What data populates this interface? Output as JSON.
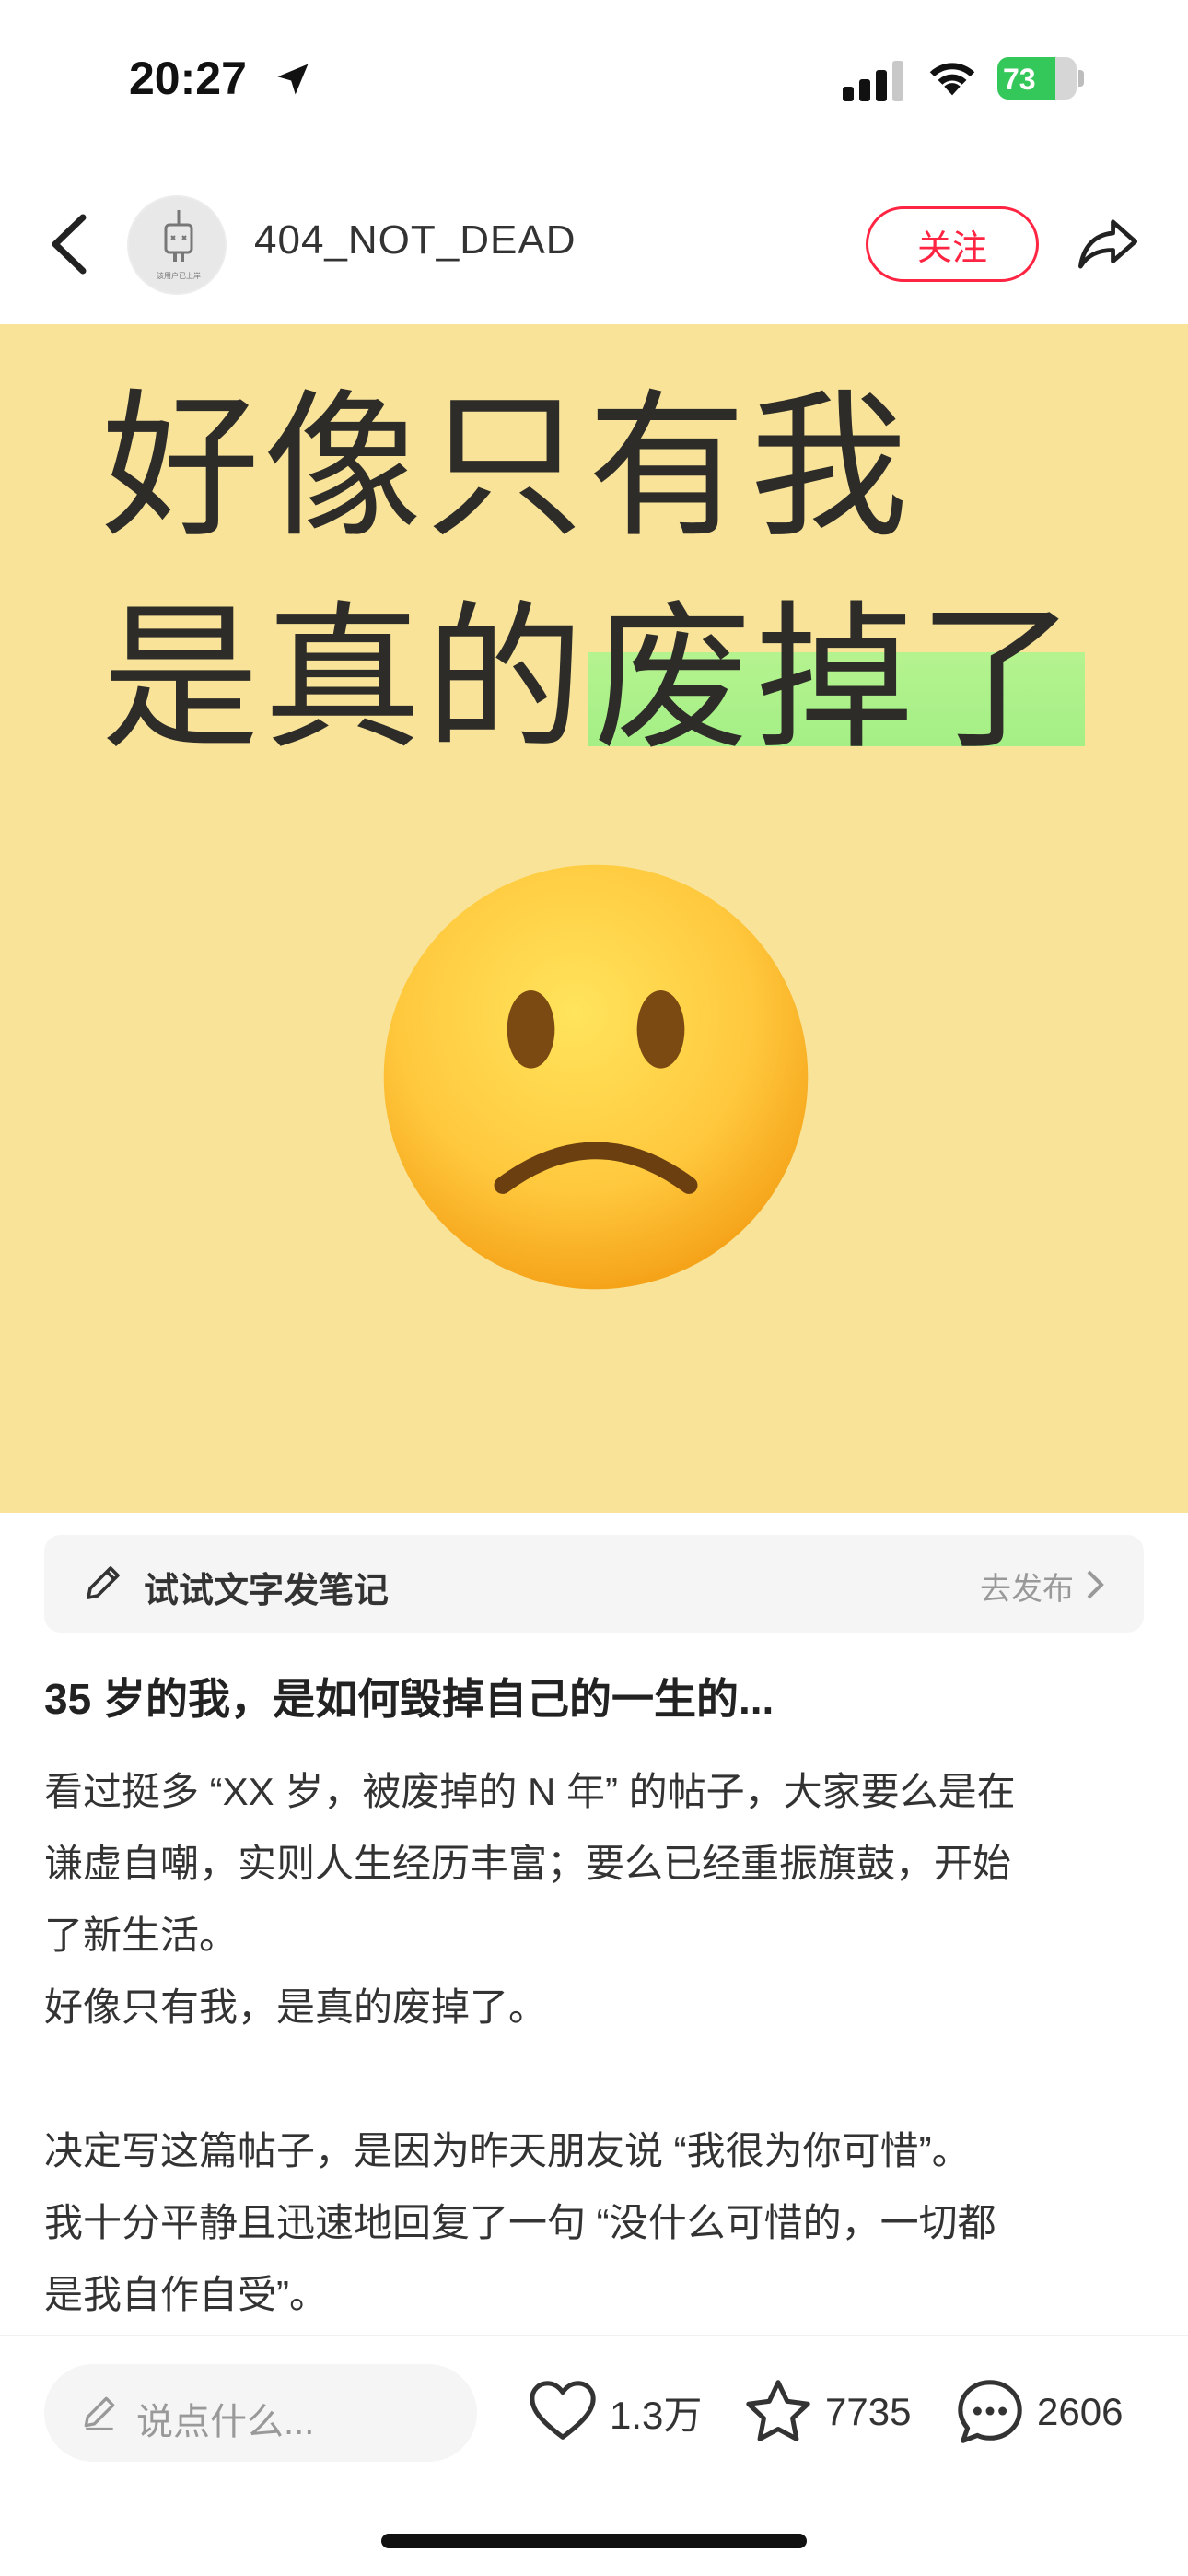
{
  "status_bar": {
    "time": "20:27",
    "battery": "73",
    "battery_level": 0.73,
    "icons": [
      "location-arrow-icon",
      "cellular-signal-icon",
      "wifi-icon",
      "battery-icon"
    ]
  },
  "header": {
    "username": "404_NOT_DEAD",
    "avatar_text": "该用户已上岸",
    "follow_label": "关注",
    "accent_color": "#ff2442",
    "icons": [
      "back-chevron-icon",
      "share-icon"
    ]
  },
  "image": {
    "background_color": "#f8e398",
    "line1": "好像只有我",
    "line2_plain": "是真的",
    "line2_highlight": "废掉了",
    "highlight_color": "#a4ef86",
    "emoji": "slightly-frowning-face-emoji"
  },
  "suggest": {
    "label": "试试文字发笔记",
    "action": "去发布",
    "icons": [
      "pencil-icon",
      "chevron-right-icon"
    ]
  },
  "post": {
    "title": "35 岁的我，是如何毁掉自己的一生的...",
    "lines": [
      "看过挺多 “XX 岁，被废掉的 N 年” 的帖子，大家要么是在",
      "谦虚自嘲，实则人生经历丰富；要么已经重振旗鼓，开始",
      "了新生活。",
      "好像只有我，是真的废掉了。",
      "",
      "决定写这篇帖子，是因为昨天朋友说 “我很为你可惜”。",
      "我十分平静且迅速地回复了一句 “没什么可惜的，一切都",
      "是我自作自受”。"
    ]
  },
  "bottom_bar": {
    "comment_placeholder": "说点什么...",
    "likes": "1.3万",
    "collects": "7735",
    "comments": "2606",
    "icons": [
      "heart-icon",
      "star-icon",
      "comment-bubble-icon"
    ]
  }
}
